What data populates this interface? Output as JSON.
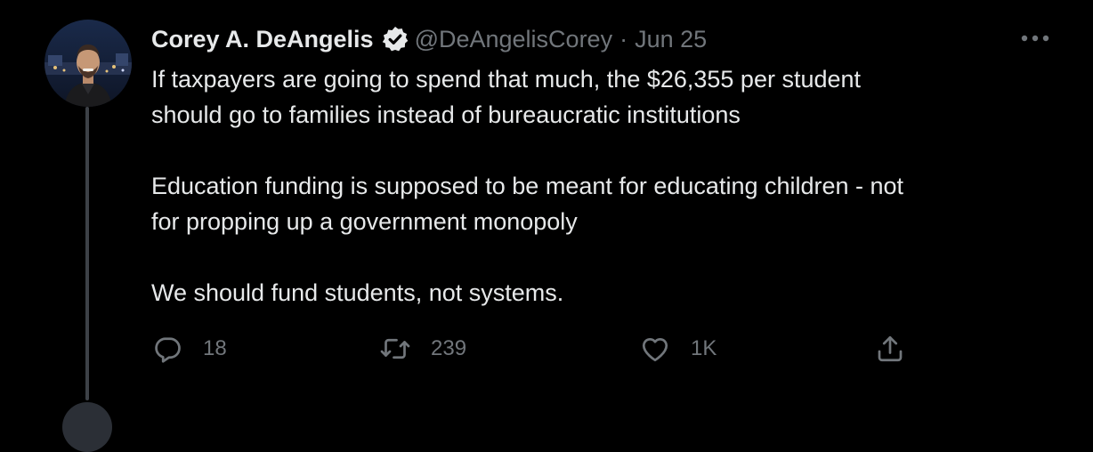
{
  "tweet": {
    "display_name": "Corey A. DeAngelis",
    "handle": "@DeAngelisCorey",
    "separator": "·",
    "date": "Jun 25",
    "lines": [
      "If taxpayers are going to spend that much, the $26,355 per student",
      "should go to families instead of bureaucratic institutions",
      "Education funding is supposed to be meant for educating children - not",
      "for propping up a government monopoly",
      "We should fund students, not systems."
    ],
    "actions": {
      "replies": "18",
      "retweets": "239",
      "likes": "1K"
    }
  },
  "icons": {
    "verified": "verified-badge-icon",
    "more": "more-horizontal-icon",
    "reply": "reply-icon",
    "retweet": "retweet-icon",
    "like": "heart-icon",
    "share": "share-icon"
  },
  "colors": {
    "background": "#000000",
    "text": "#e7e9ea",
    "secondary": "#71767b",
    "thread_line": "#3d4147"
  }
}
